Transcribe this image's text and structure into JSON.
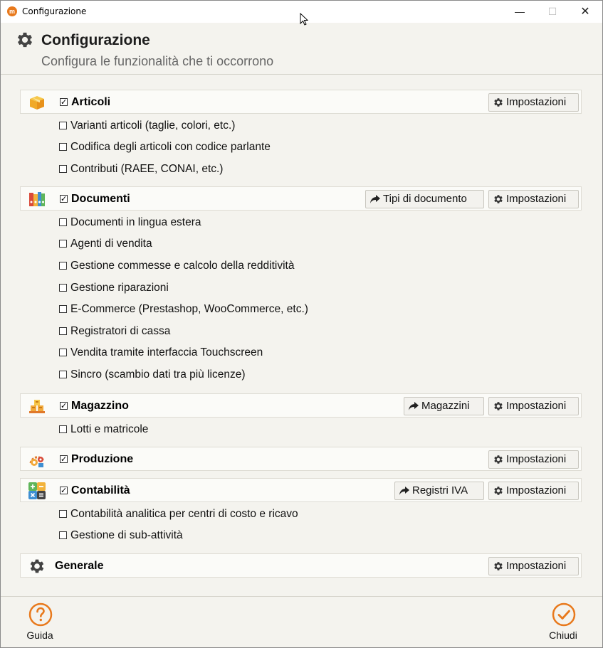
{
  "window": {
    "title": "Configurazione",
    "controls": {
      "minimize": "—",
      "maximize": "☐",
      "close": "✕"
    }
  },
  "header": {
    "title": "Configurazione",
    "subtitle": "Configura le funzionalità che ti occorrono"
  },
  "sections": {
    "articoli": {
      "label": "Articoli",
      "checked": true,
      "buttons": {
        "impostazioni": "Impostazioni"
      },
      "options": [
        {
          "label": "Varianti articoli (taglie, colori, etc.)",
          "checked": false
        },
        {
          "label": "Codifica degli articoli con codice parlante",
          "checked": false
        },
        {
          "label": "Contributi (RAEE, CONAI, etc.)",
          "checked": false
        }
      ]
    },
    "documenti": {
      "label": "Documenti",
      "checked": true,
      "buttons": {
        "tipi": "Tipi di documento",
        "impostazioni": "Impostazioni"
      },
      "options": [
        {
          "label": "Documenti in lingua estera",
          "checked": false
        },
        {
          "label": "Agenti di vendita",
          "checked": false
        },
        {
          "label": "Gestione commesse e calcolo della redditività",
          "checked": false
        },
        {
          "label": "Gestione riparazioni",
          "checked": false
        },
        {
          "label": "E-Commerce (Prestashop, WooCommerce, etc.)",
          "checked": false
        },
        {
          "label": "Registratori di cassa",
          "checked": false
        },
        {
          "label": "Vendita tramite interfaccia Touchscreen",
          "checked": false
        },
        {
          "label": "Sincro (scambio dati tra più licenze)",
          "checked": false
        }
      ]
    },
    "magazzino": {
      "label": "Magazzino",
      "checked": true,
      "buttons": {
        "magazzini": "Magazzini",
        "impostazioni": "Impostazioni"
      },
      "options": [
        {
          "label": "Lotti e matricole",
          "checked": false
        }
      ]
    },
    "produzione": {
      "label": "Produzione",
      "checked": true,
      "buttons": {
        "impostazioni": "Impostazioni"
      }
    },
    "contabilita": {
      "label": "Contabilità",
      "checked": true,
      "buttons": {
        "registri": "Registri IVA",
        "impostazioni": "Impostazioni"
      },
      "options": [
        {
          "label": "Contabilità analitica per centri di costo e ricavo",
          "checked": false
        },
        {
          "label": "Gestione di sub-attività",
          "checked": false
        }
      ]
    },
    "generale": {
      "label": "Generale",
      "buttons": {
        "impostazioni": "Impostazioni"
      }
    }
  },
  "checkmark": "✓",
  "footer": {
    "guida": "Guida",
    "chiudi": "Chiudi"
  },
  "colors": {
    "accent": "#e8791c",
    "background": "#f4f3ee",
    "section_bg": "#fbfbf8"
  },
  "icons": {
    "header": "gear-icon",
    "articoli": "box-icon",
    "documenti": "binders-icon",
    "magazzino": "warehouse-icon",
    "produzione": "production-icon",
    "contabilita": "calculator-icon",
    "generale": "gear-icon",
    "guida": "help-circle-icon",
    "chiudi": "check-circle-icon"
  }
}
